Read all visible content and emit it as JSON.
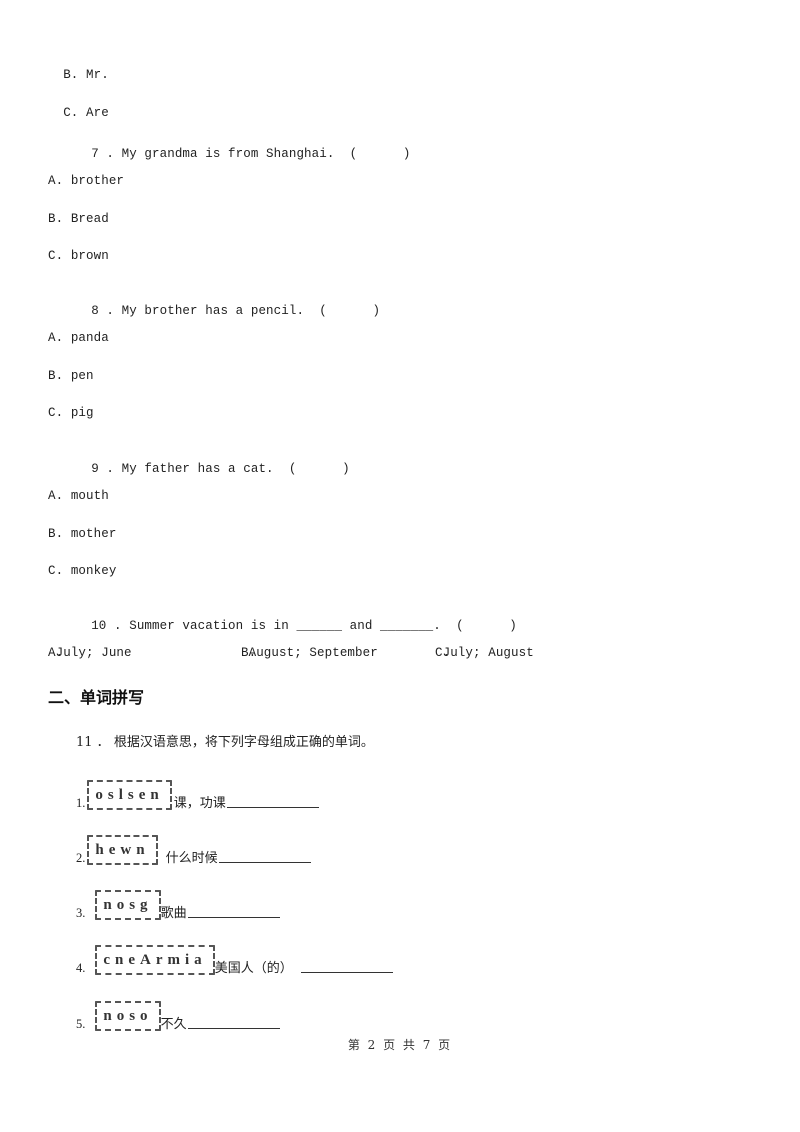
{
  "continued_options": [
    {
      "label": "B.",
      "text": "Mr."
    },
    {
      "label": "C.",
      "text": "Are"
    }
  ],
  "questions": [
    {
      "number": "7",
      "text": "My grandma is from Shanghai.",
      "paren": "(      )",
      "options": [
        {
          "label": "A.",
          "text": "brother"
        },
        {
          "label": "B.",
          "text": "Bread"
        },
        {
          "label": "C.",
          "text": "brown"
        }
      ]
    },
    {
      "number": "8",
      "text": "My brother has a pencil.",
      "paren": "(      )",
      "options": [
        {
          "label": "A.",
          "text": "panda"
        },
        {
          "label": "B.",
          "text": "pen"
        },
        {
          "label": "C.",
          "text": "pig"
        }
      ]
    },
    {
      "number": "9",
      "text": "My father has a cat.",
      "paren": "(      )",
      "options": [
        {
          "label": "A.",
          "text": "mouth"
        },
        {
          "label": "B.",
          "text": "mother"
        },
        {
          "label": "C.",
          "text": "monkey"
        }
      ]
    },
    {
      "number": "10",
      "text": "Summer vacation is in ______ and _______.",
      "paren": "(      )",
      "options": [
        {
          "label": "A.",
          "text": "July; June"
        },
        {
          "label": "B.",
          "text": "August; September"
        },
        {
          "label": "C.",
          "text": "July; August"
        }
      ]
    }
  ],
  "section2": {
    "heading": "二、单词拼写",
    "question": {
      "number": "11",
      "instruction": "根据汉语意思，将下列字母组成正确的单词。"
    },
    "items": [
      {
        "num": "1.",
        "letters": "oslsen",
        "meaning": "课，功课"
      },
      {
        "num": "2.",
        "letters": "hewn",
        "meaning": "什么时候"
      },
      {
        "num": "3.",
        "letters": "nosg",
        "meaning": "歌曲"
      },
      {
        "num": "4.",
        "letters": "cneArmia",
        "meaning": "美国人（的）"
      },
      {
        "num": "5.",
        "letters": "noso",
        "meaning": "不久"
      }
    ]
  },
  "footer": {
    "page_text": "第 2 页 共 7 页"
  }
}
